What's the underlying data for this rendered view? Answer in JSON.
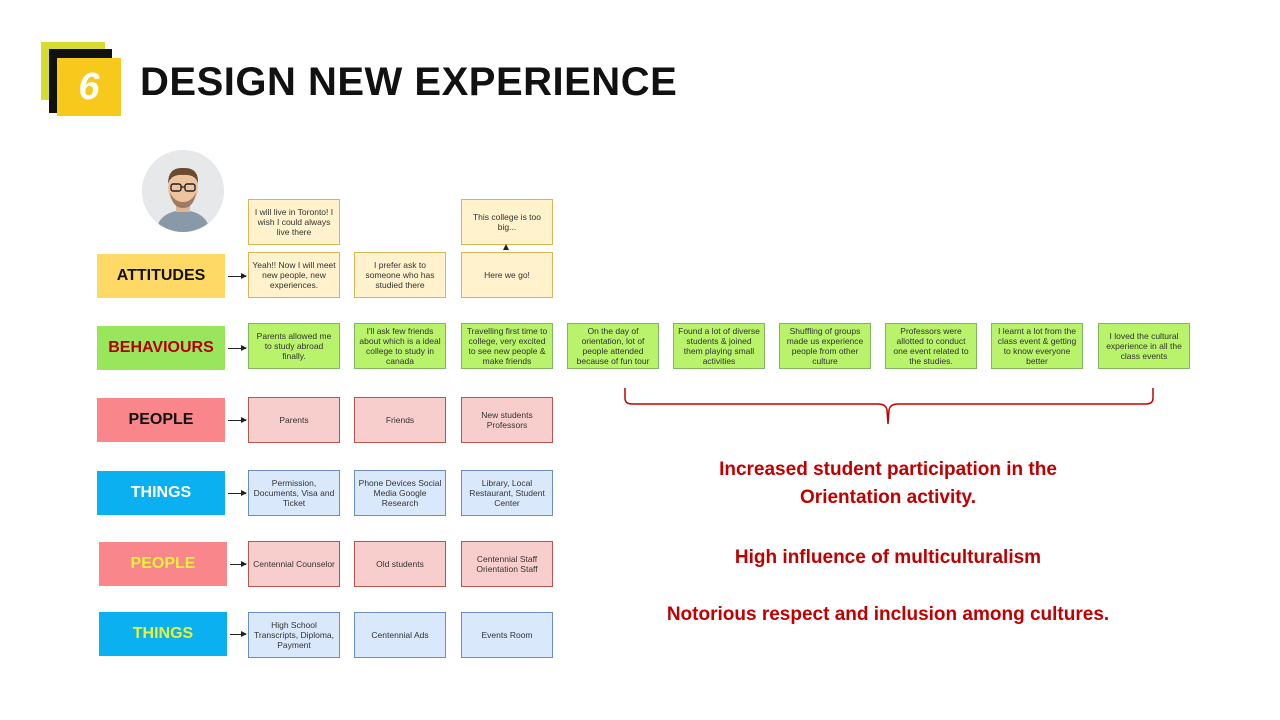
{
  "header": {
    "step_number": "6",
    "title": "DESIGN NEW EXPERIENCE"
  },
  "labels": {
    "attitudes": "ATTITUDES",
    "behaviours": "BEHAVIOURS",
    "people1": "PEOPLE",
    "things1": "THINGS",
    "people2": "PEOPLE",
    "things2": "THINGS"
  },
  "attitudes_top": [
    "I will live in Toronto! I wish I could always live there",
    "This college is too big..."
  ],
  "attitudes": [
    "Yeah!! Now I will meet new people, new experiences.",
    "I prefer ask to someone who has studied there",
    "Here we go!"
  ],
  "behaviours": [
    "Parents allowed me to study abroad finally.",
    "I'll ask few friends about which is a ideal college to study in canada",
    "Travelling first time to college, very excited to see new people & make friends",
    "On the day of orientation, lot of people attended because of fun tour",
    "Found a lot of diverse students & joined them playing small activities",
    "Shuffling of groups made us experience people from other culture",
    "Professors were allotted to conduct one event related to the studies.",
    "I learnt a lot from the class event & getting to know everyone better",
    "I loved the cultural experience in all the class events"
  ],
  "people1": [
    "Parents",
    "Friends",
    "New students Professors"
  ],
  "things1": [
    "Permission, Documents, Visa and Ticket",
    "Phone Devices Social Media Google Research",
    "Library, Local Restaurant, Student Center"
  ],
  "people2": [
    "Centennial Counselor",
    "Old students",
    "Centennial Staff Orientation Staff"
  ],
  "things2": [
    "High School Transcripts, Diploma, Payment",
    "Centennial Ads",
    "Events Room"
  ],
  "conclusions": [
    "Increased student participation in the Orientation activity.",
    "High influence of multiculturalism",
    "Notorious respect and inclusion among cultures."
  ],
  "colors": {
    "badge_yellow": "#f7c91c",
    "badge_lime": "#d6dc34",
    "attitudes_label": "#ffd966",
    "behaviours_label": "#99e65c",
    "people_label": "#f8868a",
    "things_label": "#0ab0ef",
    "conclusion_red": "#c00000"
  }
}
